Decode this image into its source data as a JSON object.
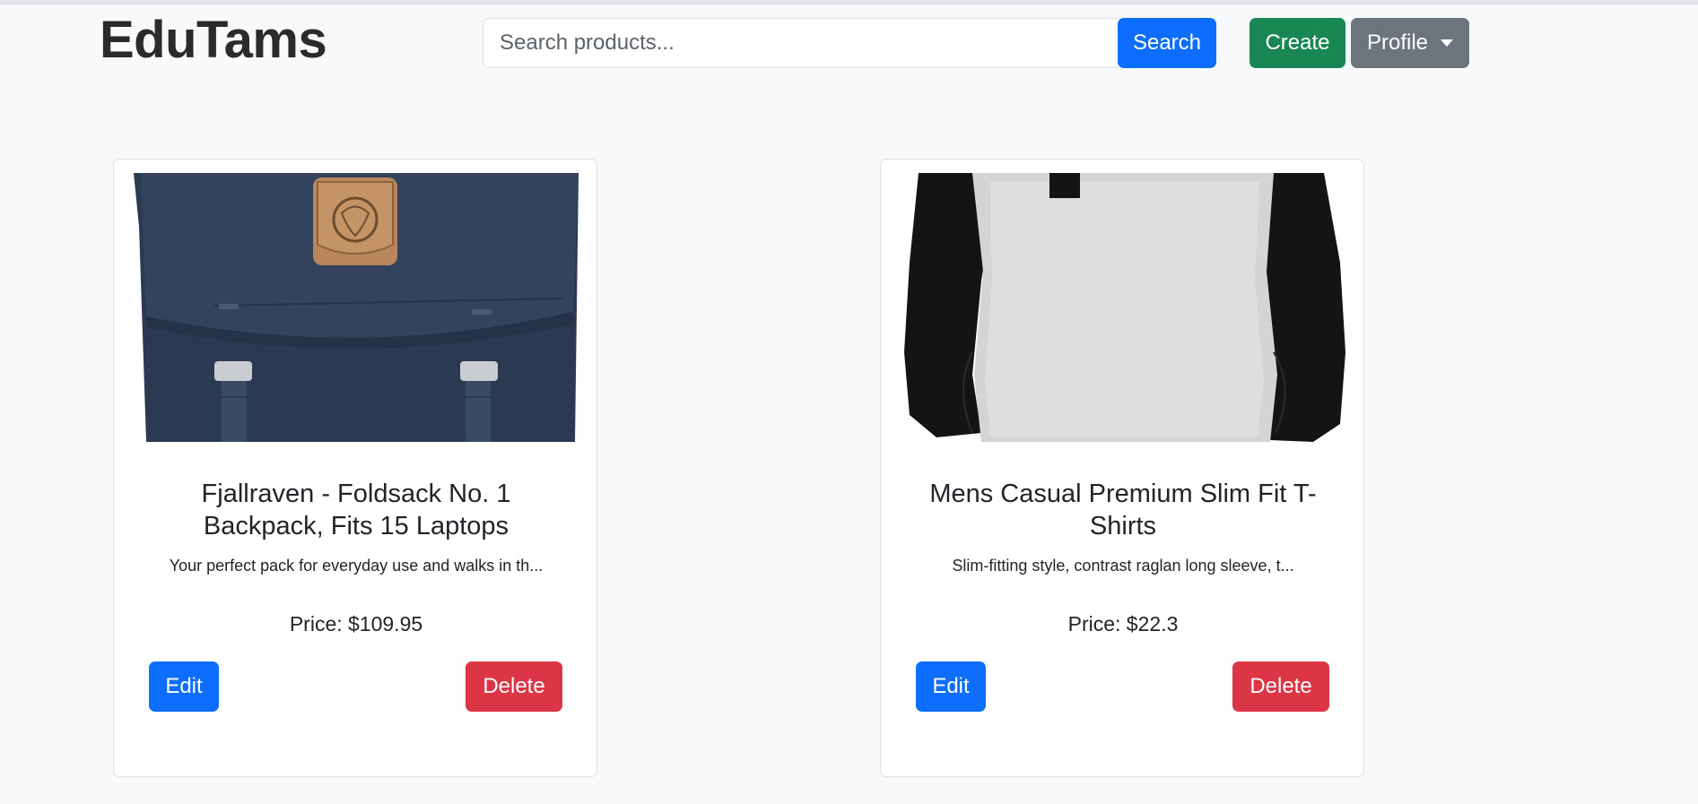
{
  "header": {
    "brand": "EduTams",
    "search": {
      "placeholder": "Search products...",
      "value": "",
      "button_label": "Search"
    },
    "create_label": "Create",
    "profile_label": "Profile"
  },
  "products": [
    {
      "image": "backpack-image",
      "title": "Fjallraven - Foldsack No. 1 Backpack, Fits 15 Laptops",
      "description": "Your perfect pack for everyday use and walks in th...",
      "price": "Price: $109.95",
      "edit_label": "Edit",
      "delete_label": "Delete"
    },
    {
      "image": "tshirt-image",
      "title": "Mens Casual Premium Slim Fit T-Shirts",
      "description": "Slim-fitting style, contrast raglan long sleeve, t...",
      "price": "Price: $22.3",
      "edit_label": "Edit",
      "delete_label": "Delete"
    }
  ],
  "colors": {
    "primary": "#0d6efd",
    "success": "#198754",
    "secondary": "#6c757d",
    "danger": "#dc3545",
    "page_background": "#f8f9fa"
  }
}
